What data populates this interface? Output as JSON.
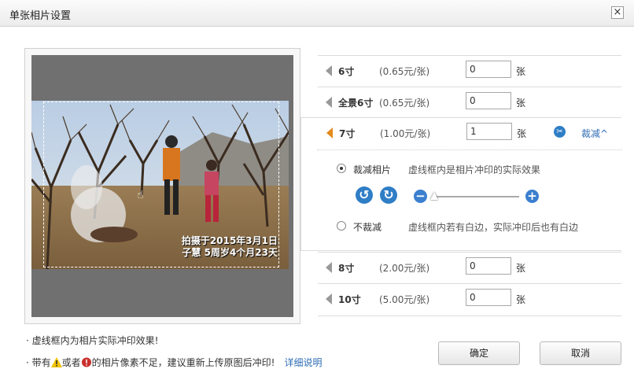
{
  "window": {
    "title": "单张相片设置",
    "close_glyph": "×"
  },
  "preview": {
    "watermark_line1": "拍摄于2015年3月1日",
    "watermark_line2": "子慧 5周岁4个月23天"
  },
  "sizes": [
    {
      "name": "6寸",
      "price": "(0.65元/张)",
      "qty": "0",
      "unit": "张",
      "active": false
    },
    {
      "name": "全景6寸",
      "price": "(0.65元/张)",
      "qty": "0",
      "unit": "张",
      "active": false
    },
    {
      "name": "7寸",
      "price": "(1.00元/张)",
      "qty": "1",
      "unit": "张",
      "active": true
    },
    {
      "name": "8寸",
      "price": "(2.00元/张)",
      "qty": "0",
      "unit": "张",
      "active": false
    },
    {
      "name": "10寸",
      "price": "(5.00元/张)",
      "qty": "0",
      "unit": "张",
      "active": false
    }
  ],
  "crop_panel": {
    "toggle_label": "裁减^",
    "crop_option": {
      "label": "裁减相片",
      "desc": "虚线框内是相片冲印的实际效果",
      "checked": true
    },
    "nocrop_option": {
      "label": "不裁减",
      "desc": "虚线框内若有白边，实际冲印后也有白边",
      "checked": false
    },
    "zoom_minus": "−",
    "zoom_plus": "+",
    "zoom_level": 0.0
  },
  "notes": {
    "line1": "· 虚线框内为相片实际冲印效果!",
    "line2_pre": "· 带有",
    "line2_mid": "或者",
    "line2_post": "的相片像素不足，建议重新上传原图后冲印!",
    "detail_link": "详细说明"
  },
  "buttons": {
    "ok": "确定",
    "cancel": "取消"
  },
  "colors": {
    "accent": "#e38b1c",
    "link": "#2f6db5",
    "icon_blue": "#2f7ec6"
  }
}
